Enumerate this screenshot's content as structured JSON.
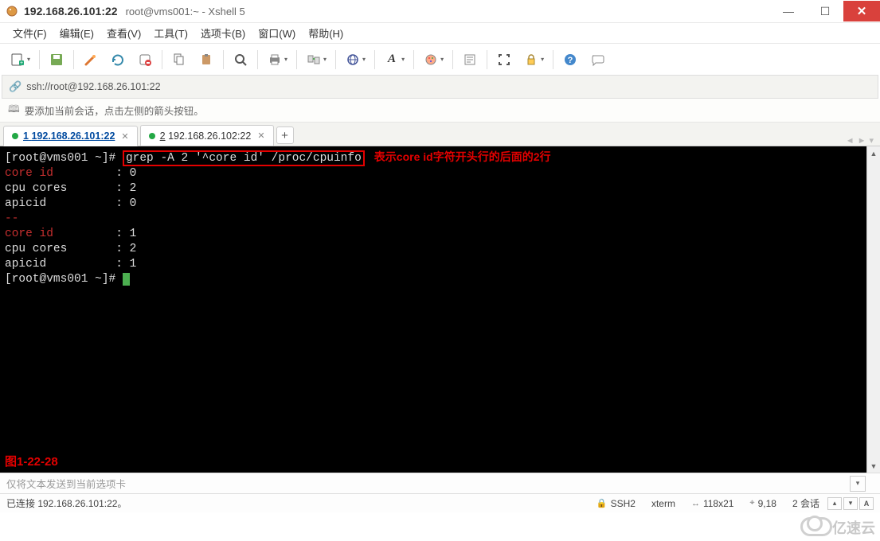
{
  "window": {
    "host": "192.168.26.101:22",
    "title_rest": "root@vms001:~ - Xshell 5"
  },
  "menu": {
    "file": "文件(F)",
    "edit": "编辑(E)",
    "view": "查看(V)",
    "tools": "工具(T)",
    "tabs": "选项卡(B)",
    "window": "窗口(W)",
    "help": "帮助(H)"
  },
  "address": {
    "url": "ssh://root@192.168.26.101:22"
  },
  "hint": {
    "text": "要添加当前会话，点击左侧的箭头按钮。"
  },
  "tabs": {
    "active": {
      "num": "1",
      "label": "192.168.26.101:22"
    },
    "other": {
      "num": "2",
      "label": "192.168.26.102:22"
    },
    "add": "+"
  },
  "terminal": {
    "prompt": "[root@vms001 ~]#",
    "command": "grep -A 2 '^core id' /proc/cpuinfo",
    "annotation": "表示core id字符开头行的后面的2行",
    "group1": {
      "core_id_label": "core id",
      "core_id_val": "0",
      "cores_label": "cpu cores",
      "cores_val": "2",
      "apic_label": "apicid",
      "apic_val": "0"
    },
    "sep": "--",
    "group2": {
      "core_id_label": "core id",
      "core_id_val": "1",
      "cores_label": "cpu cores",
      "cores_val": "2",
      "apic_label": "apicid",
      "apic_val": "1"
    },
    "figure_label": "图1-22-28"
  },
  "inputbar": {
    "placeholder": "仅将文本发送到当前选项卡"
  },
  "status": {
    "conn": "已连接 192.168.26.101:22。",
    "proto": "SSH2",
    "term": "xterm",
    "size": "118x21",
    "pos": "9,18",
    "sessions": "2 会话"
  },
  "watermark": "亿速云"
}
